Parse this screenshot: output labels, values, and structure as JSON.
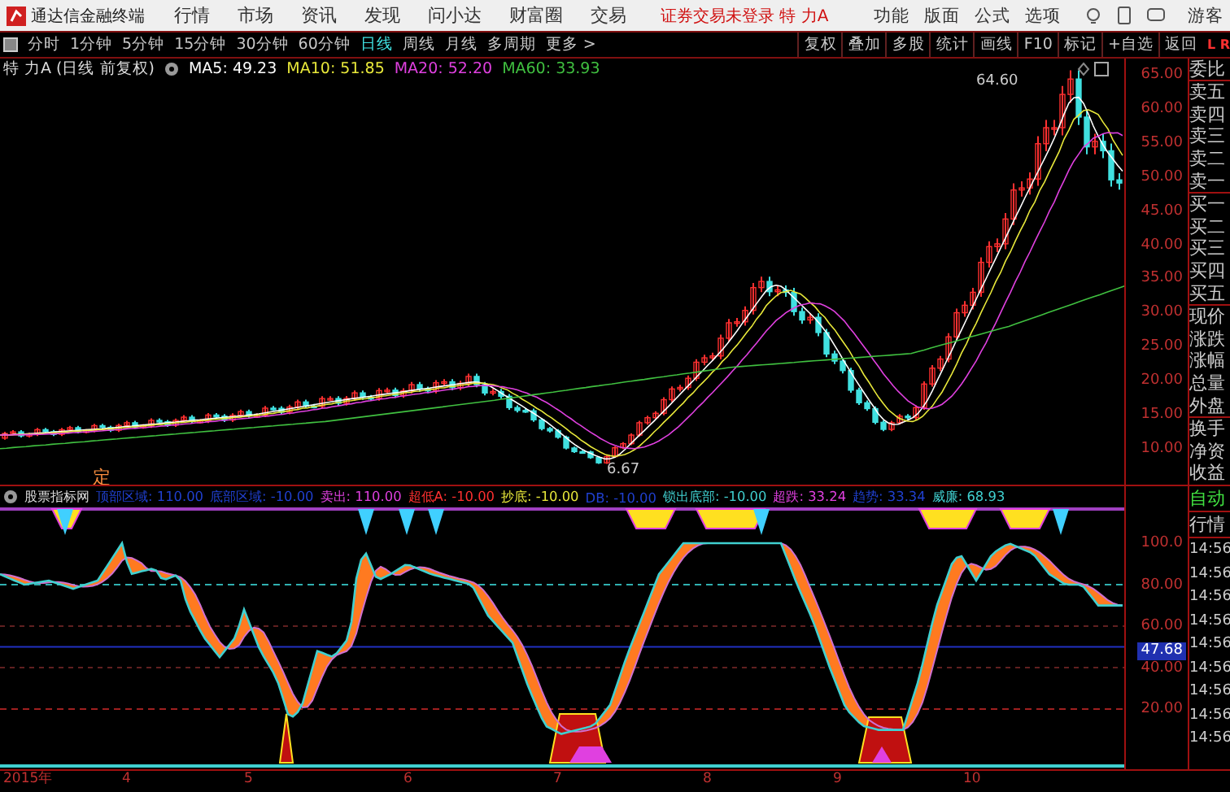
{
  "window": {
    "title": "通达信金融终端"
  },
  "menu": [
    {
      "label": "行情"
    },
    {
      "label": "市场"
    },
    {
      "label": "资讯"
    },
    {
      "label": "发现"
    },
    {
      "label": "问小达"
    },
    {
      "label": "财富圈"
    },
    {
      "label": "交易"
    }
  ],
  "login_notice": "证券交易未登录 特 力A",
  "right_menu": [
    {
      "label": "功能"
    },
    {
      "label": "版面"
    },
    {
      "label": "公式"
    },
    {
      "label": "选项"
    }
  ],
  "user": "游客",
  "period_tabs": [
    {
      "label": "分时",
      "selected": false
    },
    {
      "label": "1分钟",
      "selected": false
    },
    {
      "label": "5分钟",
      "selected": false
    },
    {
      "label": "15分钟",
      "selected": false
    },
    {
      "label": "30分钟",
      "selected": false
    },
    {
      "label": "60分钟",
      "selected": false
    },
    {
      "label": "日线",
      "selected": true
    },
    {
      "label": "周线",
      "selected": false
    },
    {
      "label": "月线",
      "selected": false
    },
    {
      "label": "多周期",
      "selected": false
    },
    {
      "label": "更多 >",
      "selected": false
    }
  ],
  "tool_buttons": [
    "复权",
    "叠加",
    "多股",
    "统计",
    "画线",
    "F10",
    "标记",
    "+自选",
    "返回"
  ],
  "corner_mark": "L R",
  "main_chart": {
    "title": "特 力A (日线 前复权)",
    "ma": [
      {
        "label": "MA5: 49.23",
        "color": "#ffffff"
      },
      {
        "label": "MA10: 51.85",
        "color": "#e8e83a"
      },
      {
        "label": "MA20: 52.20",
        "color": "#e040e0"
      },
      {
        "label": "MA60: 33.93",
        "color": "#40c040"
      }
    ],
    "high_label": "64.60",
    "low_label": "6.67",
    "marker": "定",
    "price_axis": [
      "65.00",
      "60.00",
      "55.00",
      "50.00",
      "45.00",
      "40.00",
      "35.00",
      "30.00",
      "25.00",
      "20.00",
      "15.00",
      "10.00"
    ]
  },
  "quote_labels": [
    "委比",
    "卖五",
    "卖四",
    "卖三",
    "卖二",
    "卖一",
    "买一",
    "买二",
    "买三",
    "买四",
    "买五",
    "现价",
    "涨跌",
    "涨幅",
    "总量",
    "外盘",
    "换手",
    "净资",
    "收益"
  ],
  "indicator": {
    "name": "股票指标网",
    "values": [
      {
        "label": "顶部区域: 110.00",
        "color": "#2040d0"
      },
      {
        "label": "底部区域: -10.00",
        "color": "#2040d0"
      },
      {
        "label": "卖出: 110.00",
        "color": "#e040e0"
      },
      {
        "label": "超低A: -10.00",
        "color": "#ff3030"
      },
      {
        "label": "抄底: -10.00",
        "color": "#e8e83a"
      },
      {
        "label": "DB: -10.00",
        "color": "#2040d0"
      },
      {
        "label": "锁出底部: -10.00",
        "color": "#40d0d0"
      },
      {
        "label": "超跌: 33.24",
        "color": "#e040e0"
      },
      {
        "label": "趋势: 33.34",
        "color": "#2040d0"
      },
      {
        "label": "威廉: 68.93",
        "color": "#40d0d0"
      }
    ],
    "axis": [
      "100.0",
      "80.00",
      "60.00",
      "40.00",
      "20.00"
    ],
    "current": "47.68"
  },
  "side_tabs": [
    "自动",
    "行情"
  ],
  "times": [
    "14:56",
    "14:56",
    "14:56",
    "14:56",
    "14:56",
    "14:56",
    "14:56",
    "14:56",
    "14:56"
  ],
  "x_axis": [
    "2015年",
    "4",
    "5",
    "6",
    "7",
    "8",
    "9",
    "10"
  ]
}
